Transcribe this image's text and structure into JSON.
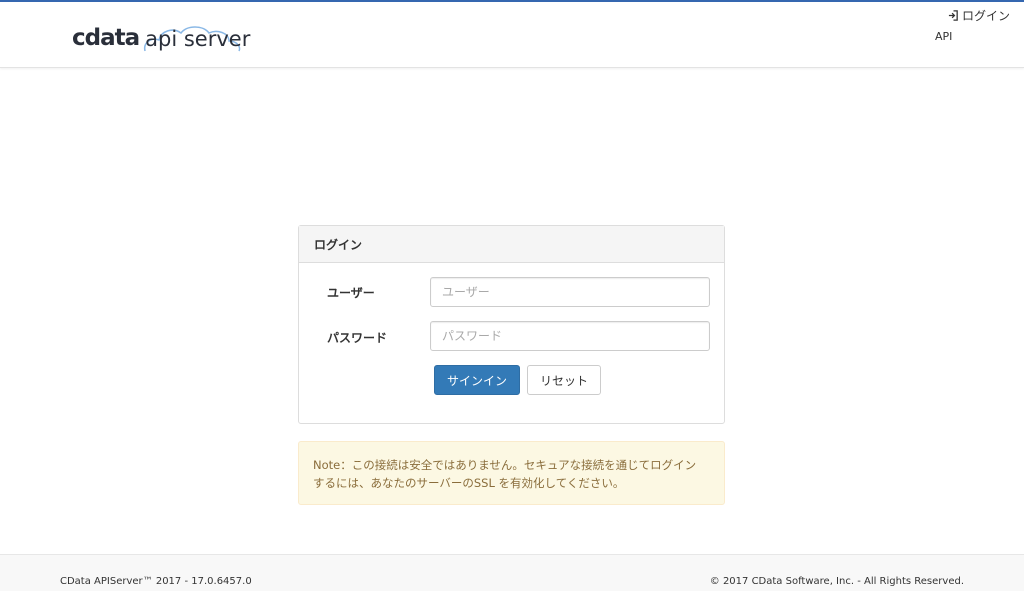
{
  "brand": {
    "logo_main": "cdata",
    "logo_sub": "api server",
    "accent_color": "#3567b0",
    "cloud_color": "#8ab8e6"
  },
  "nav": {
    "login_label": "ログイン",
    "login_icon": "sign-in-icon",
    "api_label": "API"
  },
  "login_panel": {
    "title": "ログイン",
    "user_label": "ユーザー",
    "user_placeholder": "ユーザー",
    "user_value": "",
    "password_label": "パスワード",
    "password_placeholder": "パスワード",
    "password_value": "",
    "signin_button": "サインイン",
    "signin_color": "#337ab7",
    "reset_button": "リセット"
  },
  "notice": {
    "text_line1": "Note：この接続は安全ではありません。セキュアな接続を通じてログイン",
    "text_line2": "するには、あなたのサーバーのSSL を有効化してください。"
  },
  "footer": {
    "version": "CData APIServer™ 2017 - 17.0.6457.0",
    "copyright": "© 2017 CData Software, Inc. - All Rights Reserved."
  }
}
